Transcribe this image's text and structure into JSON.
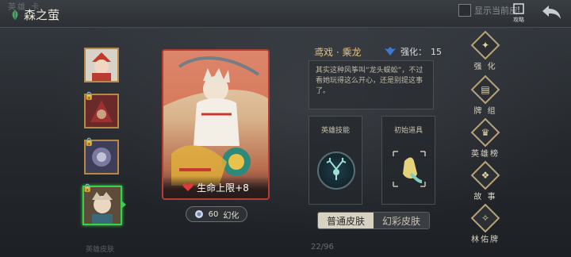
{
  "header": {
    "ghost_tab": "英雄 卡",
    "title": "森之萤",
    "show_current_label": "显示当前皮",
    "guide_label": "攻略"
  },
  "heroes": [
    {
      "name": "hero-1",
      "locked": false,
      "selected": false,
      "color": "#c7422c"
    },
    {
      "name": "hero-2",
      "locked": true,
      "selected": false,
      "color": "#7a2a2a"
    },
    {
      "name": "hero-3",
      "locked": true,
      "selected": false,
      "color": "#4a4a66"
    },
    {
      "name": "hero-4",
      "locked": true,
      "selected": true,
      "color": "#6e5a44"
    }
  ],
  "card": {
    "stat_text": "生命上限+8",
    "cost_value": "60",
    "cost_label": "幻化"
  },
  "info": {
    "name": "鸢戏 · 乘龙",
    "enhance_label": "强化：",
    "enhance_value": "15",
    "description": "其实这种风筝叫“龙头蜈蚣”，不过看她玩得这么开心，还是别提这事了。",
    "skill_title": "英雄技能",
    "item_title": "初始道具"
  },
  "skin_toggle": {
    "normal": "普通皮肤",
    "colored": "幻彩皮肤",
    "active": "normal"
  },
  "menu": [
    {
      "label": "强 化",
      "icon": "enhance-icon",
      "glyph": "✦"
    },
    {
      "label": "牌 组",
      "icon": "deck-icon",
      "glyph": "▤"
    },
    {
      "label": "英雄榜",
      "icon": "leaderboard-icon",
      "glyph": "♛"
    },
    {
      "label": "故 事",
      "icon": "story-icon",
      "glyph": "❖"
    },
    {
      "label": "林佑牌",
      "icon": "forest-card-icon",
      "glyph": "✧"
    }
  ],
  "footer": {
    "pager": "22/96",
    "ghost": "英雄皮肤"
  }
}
